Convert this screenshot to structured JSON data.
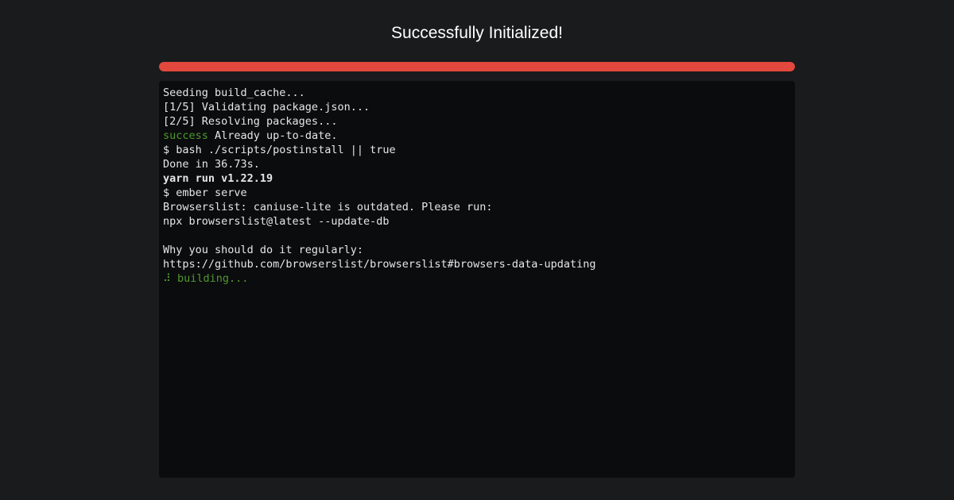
{
  "header": {
    "title": "Successfully Initialized!"
  },
  "progress": {
    "fraction": 1.0,
    "color": "#e2483d"
  },
  "terminal": {
    "lines": [
      {
        "parts": [
          {
            "text": "Seeding build_cache..."
          }
        ]
      },
      {
        "parts": [
          {
            "text": "[1/5] Validating package.json..."
          }
        ]
      },
      {
        "parts": [
          {
            "text": "[2/5] Resolving packages..."
          }
        ]
      },
      {
        "parts": [
          {
            "text": "success",
            "style": "green"
          },
          {
            "text": " Already up-to-date."
          }
        ]
      },
      {
        "parts": [
          {
            "text": "$ bash ./scripts/postinstall || true"
          }
        ]
      },
      {
        "parts": [
          {
            "text": "Done in 36.73s."
          }
        ]
      },
      {
        "parts": [
          {
            "text": "yarn run v1.22.19",
            "style": "bold"
          }
        ]
      },
      {
        "parts": [
          {
            "text": "$ ember serve"
          }
        ]
      },
      {
        "parts": [
          {
            "text": "Browserslist: caniuse-lite is outdated. Please run:"
          }
        ]
      },
      {
        "parts": [
          {
            "text": "npx browserslist@latest --update-db"
          }
        ]
      },
      {
        "parts": [
          {
            "text": ""
          }
        ]
      },
      {
        "parts": [
          {
            "text": "Why you should do it regularly:"
          }
        ]
      },
      {
        "parts": [
          {
            "text": "https://github.com/browserslist/browserslist#browsers-data-updating"
          }
        ]
      },
      {
        "parts": [
          {
            "text": "⠼ building...",
            "style": "green"
          }
        ]
      }
    ]
  }
}
